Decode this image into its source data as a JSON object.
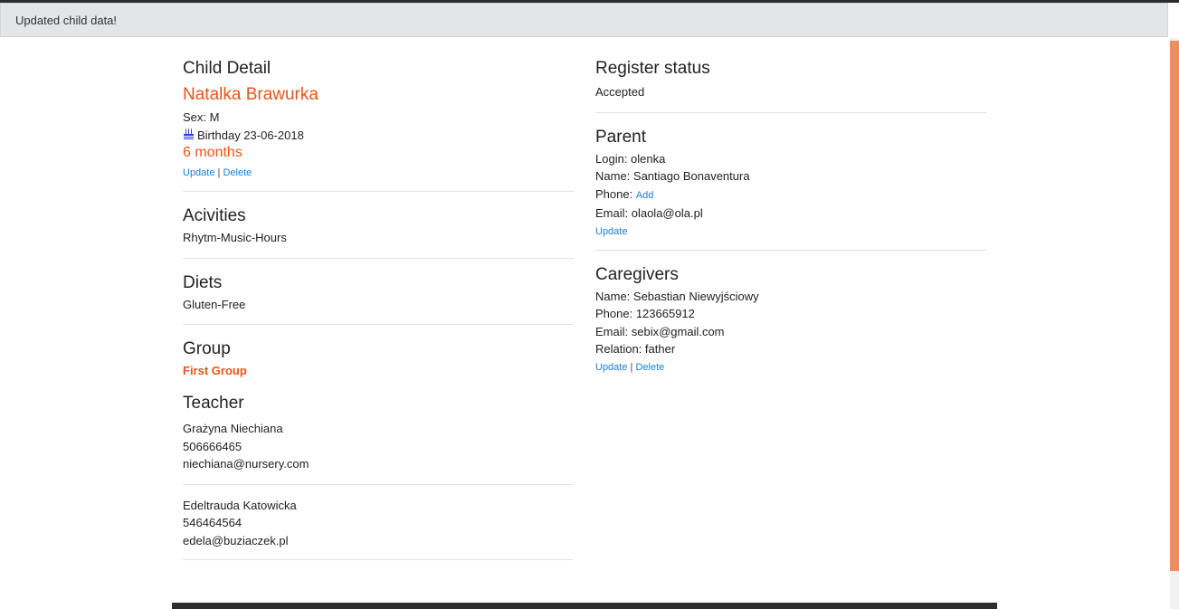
{
  "alert": {
    "message": "Updated child data!"
  },
  "child": {
    "heading": "Child Detail",
    "name": "Natalka Brawurka",
    "sex": "Sex: M",
    "birthday": "Birthday 23-06-2018",
    "age": "6 months",
    "update_label": "Update",
    "separator": "|",
    "delete_label": "Delete"
  },
  "activities": {
    "heading": "Acivities",
    "items": [
      "Rhytm-Music-Hours"
    ]
  },
  "diets": {
    "heading": "Diets",
    "items": [
      "Gluten-Free"
    ]
  },
  "group": {
    "heading": "Group",
    "name": "First Group"
  },
  "teacher": {
    "heading": "Teacher",
    "list": [
      {
        "name": "Grażyna Niechiana",
        "phone": "506666465",
        "email": "niechiana@nursery.com"
      },
      {
        "name": "Edeltrauda Katowicka",
        "phone": "546464564",
        "email": "edela@buziaczek.pl"
      }
    ]
  },
  "register": {
    "heading": "Register status",
    "status": "Accepted"
  },
  "parent": {
    "heading": "Parent",
    "login": "Login: olenka",
    "name": "Name: Santiago Bonaventura",
    "phone_label": "Phone:",
    "phone_add": "Add",
    "email": "Email: olaola@ola.pl",
    "update_label": "Update"
  },
  "caregivers": {
    "heading": "Caregivers",
    "name": "Name: Sebastian Niewyjściowy",
    "phone": "Phone: 123665912",
    "email": "Email: sebix@gmail.com",
    "relation": "Relation: father",
    "update_label": "Update",
    "separator": "|",
    "delete_label": "Delete"
  },
  "colors": {
    "accent": "#e8541c",
    "link": "#1a7fd4",
    "alert_bg": "#e4e5e7",
    "scroll_thumb": "#ef8d5f"
  },
  "icons": {
    "birthday": "birthday-cake-icon"
  }
}
